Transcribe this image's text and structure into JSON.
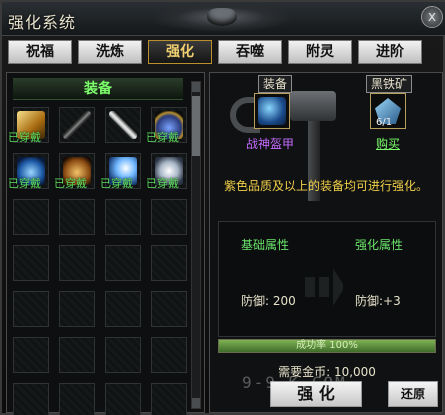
{
  "window": {
    "title": "强化系统",
    "close_label": "x"
  },
  "tabs": [
    {
      "label": "祝福",
      "active": false
    },
    {
      "label": "洗炼",
      "active": false
    },
    {
      "label": "强化",
      "active": true
    },
    {
      "label": "吞噬",
      "active": false
    },
    {
      "label": "附灵",
      "active": false
    },
    {
      "label": "进阶",
      "active": false
    }
  ],
  "inventory": {
    "header": "装备",
    "equipped_tag": "已穿戴",
    "items": [
      {
        "icon": "golden-claw-icon",
        "equipped": true
      },
      {
        "icon": "dark-staff-icon",
        "equipped": false
      },
      {
        "icon": "short-sword-icon",
        "equipped": false
      },
      {
        "icon": "leaf-ornament-icon",
        "equipped": true
      },
      {
        "icon": "blue-helmet-icon",
        "equipped": true
      },
      {
        "icon": "bronze-boots-icon",
        "equipped": true
      },
      {
        "icon": "blue-wing-icon",
        "equipped": true
      },
      {
        "icon": "white-armor-icon",
        "equipped": true
      }
    ]
  },
  "strengthen": {
    "equip_slot_label": "装备",
    "ore_slot_label": "黑铁矿",
    "ore_count": "6/1",
    "equip_name": "战神盔甲",
    "buy_label": "购买",
    "hint": "紫色品质及以上的装备均可进行强化。",
    "base_attr_header": "基础属性",
    "upgrade_attr_header": "强化属性",
    "base_attr_value": "防御: 200",
    "upgrade_attr_value": "防御:+3",
    "success_rate_label": "成功率 100%",
    "success_rate": 1.0,
    "gold_label": "需要金币:",
    "gold_value": "10,000",
    "strengthen_button": "强 化",
    "reset_button": "还原"
  },
  "watermark": "9-9-K.COM",
  "colors": {
    "equipped_text": "#5fe05f",
    "hint_text": "#f2d04a",
    "purple_name": "#c46bff",
    "active_tab_text": "#f0d070"
  }
}
